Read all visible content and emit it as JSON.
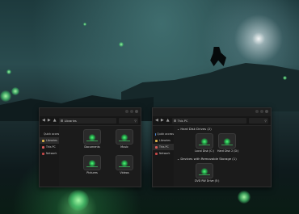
{
  "accent_color": "#3fcf65",
  "left_window": {
    "breadcrumb": "Libraries",
    "nav": [
      "Quick access",
      "Libraries",
      "This PC",
      "Network"
    ],
    "active_nav": 1,
    "folders": [
      "Documents",
      "Music",
      "Pictures",
      "Videos"
    ]
  },
  "right_window": {
    "breadcrumb": "This PC",
    "nav": [
      "Quick access",
      "Libraries",
      "This PC",
      "Network"
    ],
    "active_nav": 2,
    "groups": {
      "hard_disk": "Hard Disk Drives (2)",
      "removable": "Devices with Removable Storage (1)"
    },
    "drives": [
      "Local Disk (C:)",
      "Hard Disk 2 (D:)"
    ],
    "removable_drives": [
      "DVD RW Drive (E:)"
    ]
  },
  "icons": {
    "back": "back-arrow-icon",
    "forward": "forward-arrow-icon",
    "up": "up-arrow-icon",
    "search": "search-icon",
    "folder": "folder-icon",
    "drive": "drive-icon"
  }
}
